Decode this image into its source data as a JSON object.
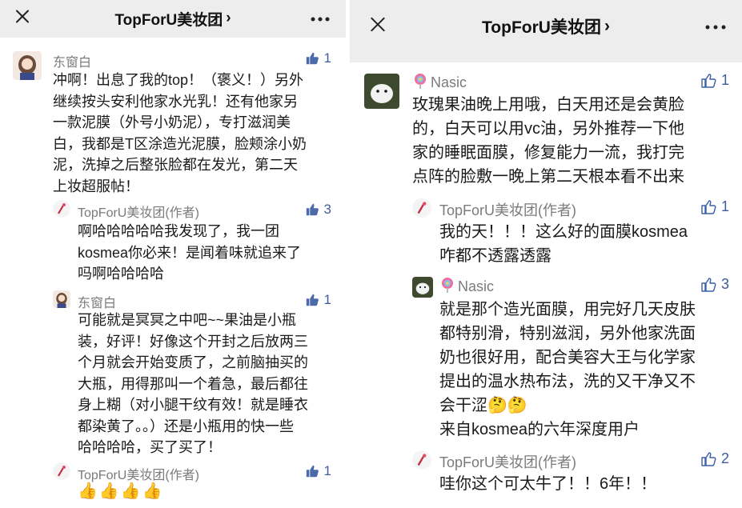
{
  "colors": {
    "link": "#3b5fa8",
    "author": "#7b7b7b",
    "background": "#ededed"
  },
  "left": {
    "nav": {
      "title": "TopForU美妆团",
      "chevron": "›",
      "more_icon": "more-dots-icon",
      "close_icon": "close-icon"
    },
    "comments": [
      {
        "author": "东窗白",
        "likes": "1",
        "body": [
          "冲啊！出息了我的top！（褒义！）另外",
          "继续按头安利他家水光乳！还有他家另",
          "一款泥膜（外号小奶泥），专打滋润美",
          "白，我都是T区涂造光泥膜，脸颊涂小奶",
          "泥，洗掉之后整张脸都在发光，第二天",
          "上妆超服帖！"
        ]
      },
      {
        "author": "TopForU美妆团(作者)",
        "likes": "3",
        "body": [
          "啊哈哈哈哈哈我发现了，我一团",
          "kosmea你必来！是闻着味就追来了",
          "吗啊哈哈哈哈"
        ]
      },
      {
        "author": "东窗白",
        "likes": "1",
        "body": [
          "可能就是冥冥之中吧~~果油是小瓶",
          "装，好评！好像这个开封之后放两三",
          "个月就会开始变质了，之前脑抽买的",
          "大瓶，用得那叫一个着急，最后都往",
          "身上糊（对小腿干纹有效！就是睡衣",
          "都染黄了。。）还是小瓶用的快一些",
          "哈哈哈哈，买了买了！"
        ]
      },
      {
        "author": "TopForU美妆团(作者)",
        "likes": "1",
        "emoji": [
          "👍",
          "👍",
          "👍",
          "👍"
        ]
      }
    ]
  },
  "right": {
    "nav": {
      "title": "TopForU美妆团",
      "chevron": "›",
      "more_icon": "more-dots-icon",
      "close_icon": "close-icon"
    },
    "comments": [
      {
        "author": "Nasic",
        "likes": "1",
        "body": [
          "玫瑰果油晚上用哦，白天用还是会黄脸",
          "的，白天可以用vc油，另外推荐一下他",
          "家的睡眠面膜，修复能力一流，我打完",
          "点阵的脸敷一晚上第二天根本看不出来"
        ]
      },
      {
        "author": "TopForU美妆团(作者)",
        "likes": "1",
        "body": [
          "我的天！！！这么好的面膜kosmea",
          "咋都不透露透露"
        ]
      },
      {
        "author": "Nasic",
        "likes": "3",
        "body": [
          "就是那个造光面膜，用完好几天皮肤",
          "都特别滑，特别滋润，另外他家洗面",
          "奶也很好用，配合美容大王与化学家",
          "提出的温水热布法，洗的又干净又不",
          "会干涩🤔🤔",
          "来自kosmea的六年深度用户"
        ]
      },
      {
        "author": "TopForU美妆团(作者)",
        "likes": "2",
        "body": [
          "哇你这个可太牛了！！6年！！"
        ]
      }
    ]
  }
}
